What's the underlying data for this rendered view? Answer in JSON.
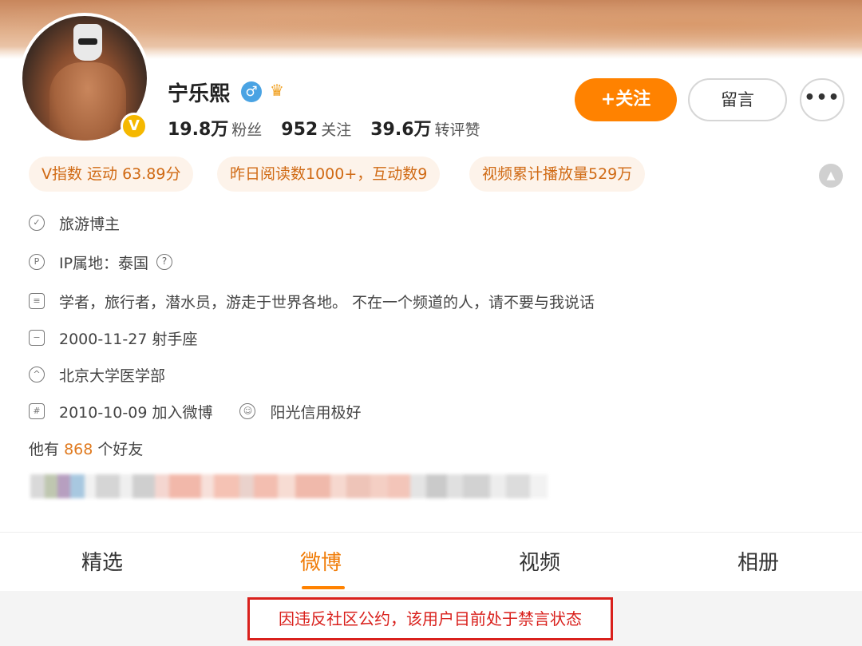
{
  "profile": {
    "name": "宁乐熙",
    "stats": [
      {
        "value": "19.8万",
        "label": "粉丝"
      },
      {
        "value": "952",
        "label": "关注"
      },
      {
        "value": "39.6万",
        "label": "转评赞"
      }
    ],
    "verified_badge": "V"
  },
  "actions": {
    "follow_label": "+关注",
    "message_label": "留言",
    "more_label": "•••"
  },
  "tags": [
    "V指数 运动 63.89分",
    "昨日阅读数1000+，互动数9",
    "视频累计播放量529万"
  ],
  "info": {
    "role": "旅游博主",
    "ip_location": "IP属地：泰国",
    "bio": "学者，旅行者，潜水员，游走于世界各地。 不在一个频道的人，请不要与我说话",
    "birthday": "2000-11-27 射手座",
    "school": "北京大学医学部",
    "joined": "2010-10-09 加入微博",
    "credit": "阳光信用极好"
  },
  "friends": {
    "prefix": "他有",
    "count": "868",
    "suffix": "个好友"
  },
  "tabs": [
    "精选",
    "微博",
    "视频",
    "相册"
  ],
  "active_tab": "微博",
  "notice": "因违反社区公约，该用户目前处于禁言状态",
  "colors": {
    "accent": "#ff8200",
    "tag_bg": "#fdf3ea",
    "tag_text": "#d06a14",
    "notice_red": "#d9201c"
  },
  "icons": {
    "role": "shield-check-icon",
    "ip": "ip-pin-icon",
    "bio": "document-icon",
    "birthday": "calendar-icon",
    "school": "graduation-cap-icon",
    "joined": "calendar-grid-icon",
    "credit": "sunshine-credit-icon"
  }
}
